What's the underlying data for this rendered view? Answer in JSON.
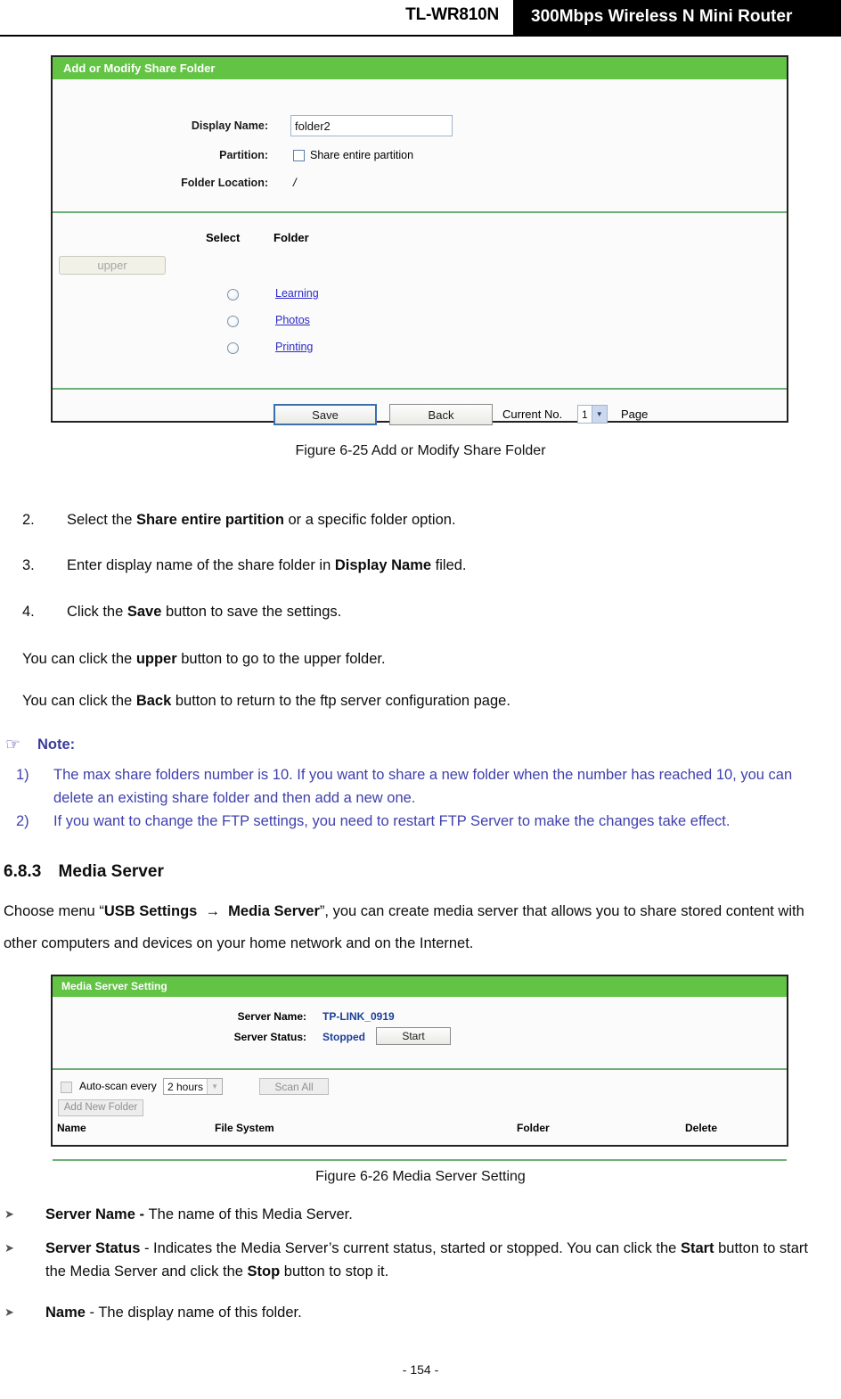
{
  "header": {
    "model": "TL-WR810N",
    "product": "300Mbps Wireless N Mini Router"
  },
  "share_folder_panel": {
    "title": "Add or Modify Share Folder",
    "fields": {
      "display_name_label": "Display Name:",
      "display_name_value": "folder2",
      "partition_label": "Partition:",
      "share_entire_partition_label": "Share entire partition",
      "folder_location_label": "Folder Location:",
      "folder_location_value": "/"
    },
    "table": {
      "col_select": "Select",
      "col_folder": "Folder",
      "upper_button": "upper",
      "rows": [
        {
          "folder": "Learning"
        },
        {
          "folder": "Photos"
        },
        {
          "folder": "Printing"
        }
      ]
    },
    "footer": {
      "save_button": "Save",
      "back_button": "Back",
      "current_no_label": "Current No.",
      "current_page_value": "1",
      "page_label": "Page"
    }
  },
  "figure_625_caption": "Figure 6-25 Add or Modify Share Folder",
  "steps": [
    {
      "num": "2.",
      "html": "Select the <b>Share entire partition</b> or a specific folder option."
    },
    {
      "num": "3.",
      "html": "Enter display name of the share folder in <b>Display Name</b> filed."
    },
    {
      "num": "4.",
      "html": "Click the <b>Save</b> button to save the settings."
    }
  ],
  "paragraphs": [
    "You can click the <b>upper</b> button to go to the upper folder.",
    "You can click the <b>Back</b> button to return to the ftp server configuration page."
  ],
  "note": {
    "hand_icon": "☞",
    "title": "Note:",
    "items": [
      {
        "num": "1)",
        "text": "The max share folders number is 10. If you want to share a new folder when the number has reached 10, you can delete an existing share folder and then add a new one."
      },
      {
        "num": "2)",
        "text": "If you want to change the FTP settings, you need to restart FTP Server to make the changes take effect."
      }
    ]
  },
  "section": {
    "number": "6.8.3",
    "title": "Media Server",
    "intro_html": "Choose menu “<b>USB Settings</b>  →  <b>Media Server</b>”, you can create media server that allows you to share stored content with other computers and devices on your home network and on the Internet."
  },
  "media_server_panel": {
    "title": "Media Server Setting",
    "server_name_label": "Server Name:",
    "server_name_value": "TP-LINK_0919",
    "server_status_label": "Server Status:",
    "server_status_value": "Stopped",
    "start_button": "Start",
    "autoscan_label": "Auto-scan every",
    "autoscan_interval": "2 hours",
    "scan_all_button": "Scan All",
    "add_new_folder_button": "Add New Folder",
    "table_headers": {
      "name": "Name",
      "file_system": "File System",
      "folder": "Folder",
      "delete": "Delete"
    }
  },
  "figure_626_caption": "Figure 6-26 Media Server Setting",
  "bullets": [
    {
      "html": "<b>Server Name - </b>The name of this Media Server."
    },
    {
      "html": "<b>Server Status</b> - Indicates the Media Server’s current status, started or stopped. You can click the <b>Start</b> button to start the Media Server and click the <b>Stop</b> button to stop it."
    },
    {
      "html": "<b>Name</b> - The display name of this folder."
    }
  ],
  "page_number": "- 154 -",
  "colors": {
    "panel_green": "#62c344",
    "separator_green": "#6fae79",
    "link_blue": "#2b29c8",
    "note_blue": "#3f3fae",
    "value_blue": "#1b3f96"
  }
}
